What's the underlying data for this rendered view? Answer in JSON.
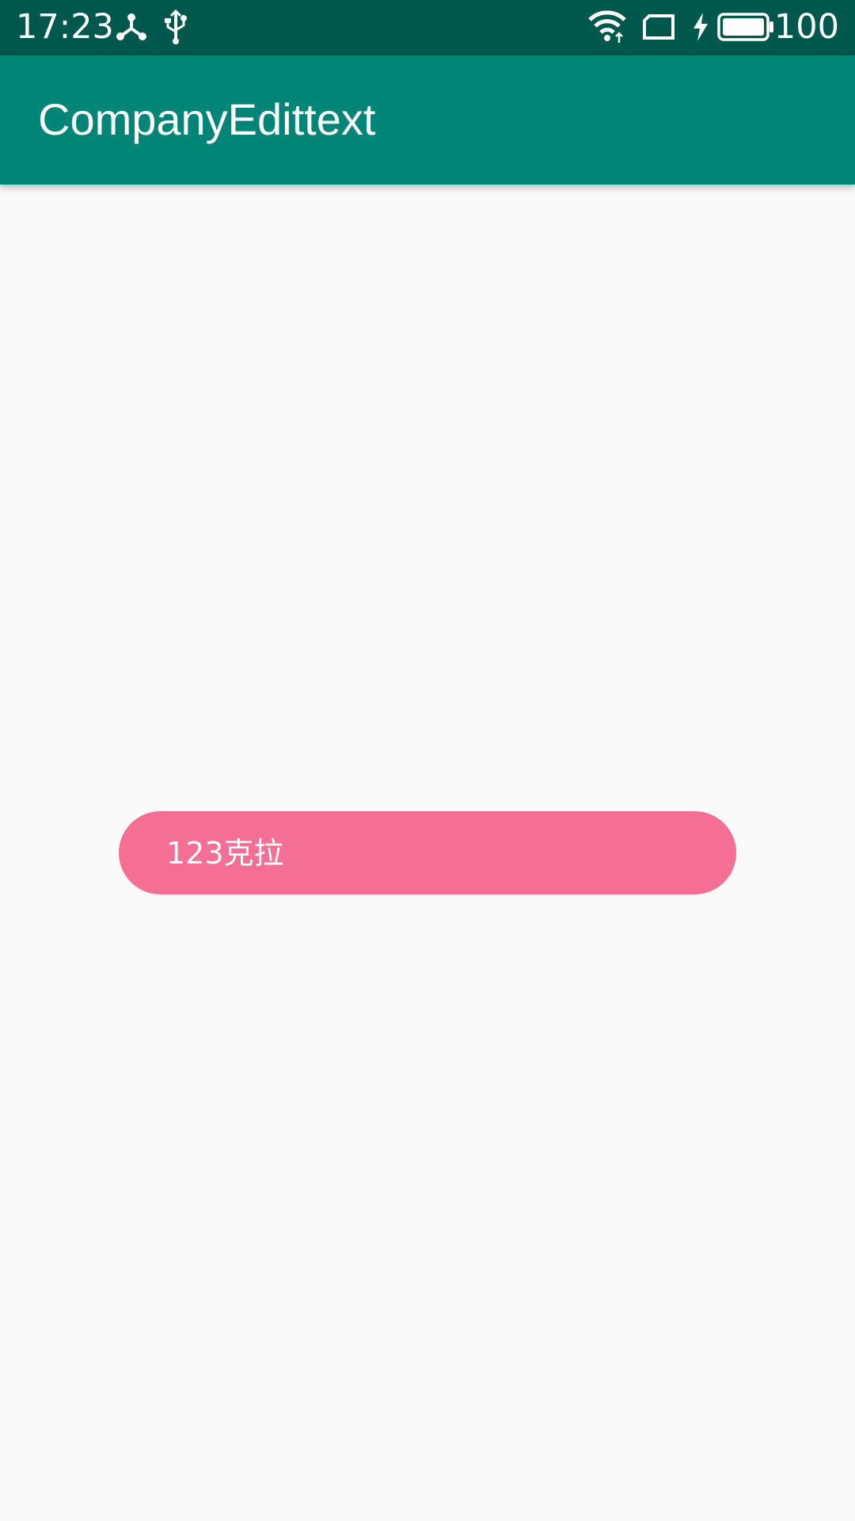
{
  "status_bar": {
    "time": "17:23",
    "battery_percent": "100",
    "icons": [
      "network-share-icon",
      "usb-icon",
      "wifi-icon",
      "screen-icon",
      "charging-icon",
      "battery-icon"
    ],
    "background_color": "#00574b"
  },
  "app_bar": {
    "title": "CompanyEdittext",
    "background_color": "#008577"
  },
  "main": {
    "company_edittext": {
      "value": "123克拉",
      "background_color": "#f46f93",
      "text_color": "#ffffff"
    }
  },
  "page_background": "#fafafa"
}
